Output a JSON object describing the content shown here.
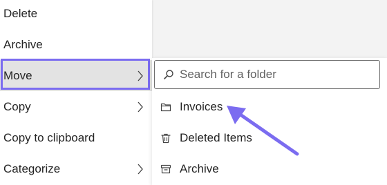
{
  "menu": {
    "items": [
      {
        "label": "Delete",
        "has_submenu": false
      },
      {
        "label": "Archive",
        "has_submenu": false
      },
      {
        "label": "Move",
        "has_submenu": true
      },
      {
        "label": "Copy",
        "has_submenu": true
      },
      {
        "label": "Copy to clipboard",
        "has_submenu": false
      },
      {
        "label": "Categorize",
        "has_submenu": true
      }
    ],
    "selected": "Move"
  },
  "submenu": {
    "search": {
      "placeholder": "Search for a folder",
      "icon": "search-icon"
    },
    "folders": [
      {
        "label": "Invoices",
        "icon": "folder-icon"
      },
      {
        "label": "Deleted Items",
        "icon": "trash-icon"
      },
      {
        "label": "Archive",
        "icon": "archive-icon"
      }
    ]
  },
  "colors": {
    "highlight": "#7b6cf0",
    "selected_bg": "#e3e3e3",
    "arrow": "#7b6cf0"
  }
}
